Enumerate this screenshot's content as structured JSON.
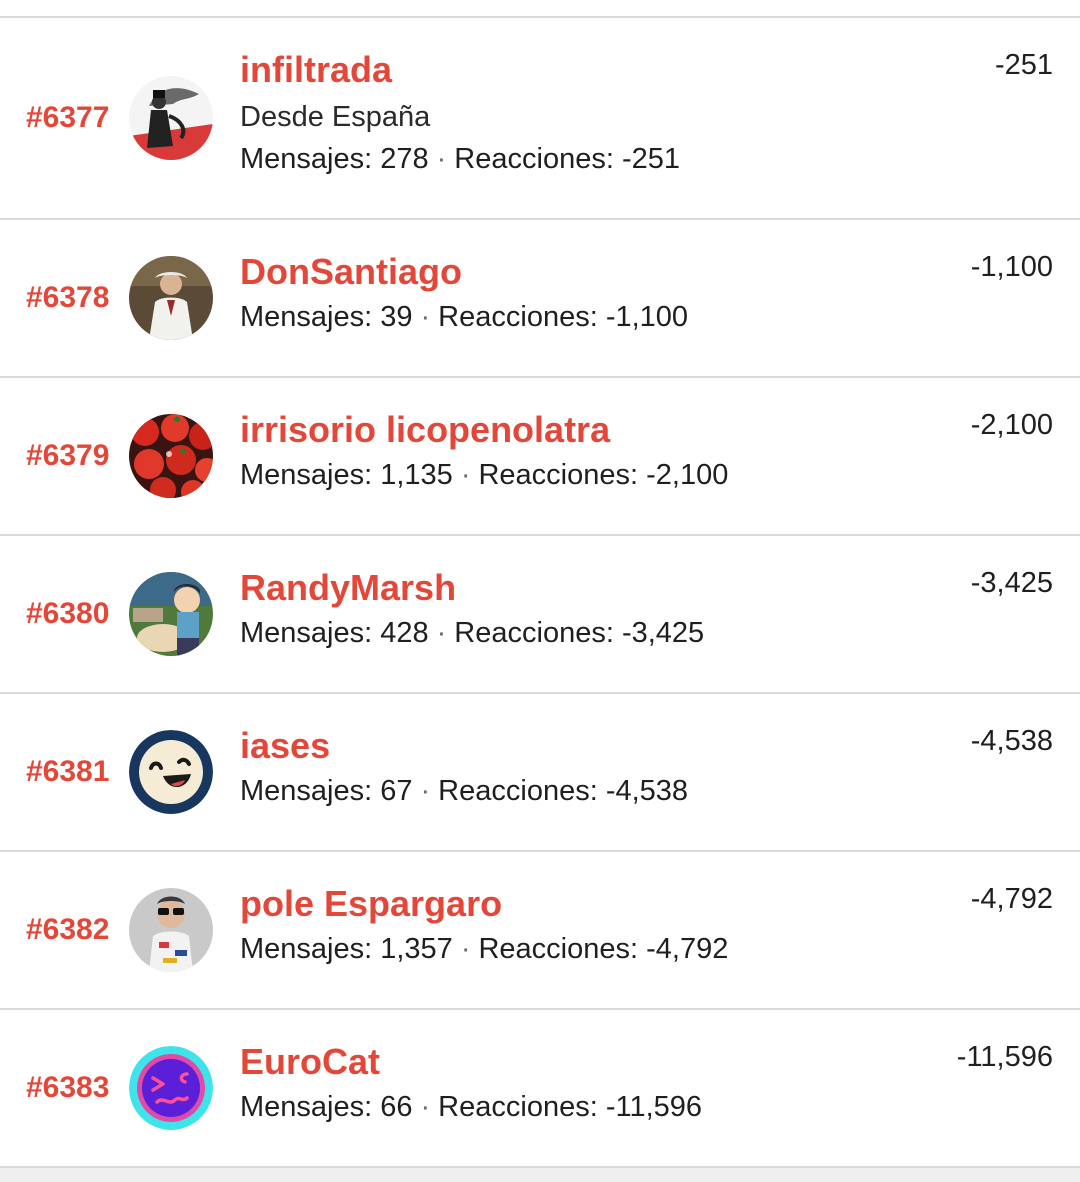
{
  "members": [
    {
      "rank": "#6377",
      "name": "infiltrada",
      "location": "Desde España",
      "messages_label": "Mensajes:",
      "messages": "278",
      "separator": "·",
      "reactions_label": "Reacciones:",
      "reactions": "-251",
      "score": "-251",
      "avatar_icon": "sketch-figure-avatar"
    },
    {
      "rank": "#6378",
      "name": "DonSantiago",
      "messages_label": "Mensajes:",
      "messages": "39",
      "separator": "·",
      "reactions_label": "Reacciones:",
      "reactions": "-1,100",
      "score": "-1,100",
      "avatar_icon": "man-in-white-coat-avatar"
    },
    {
      "rank": "#6379",
      "name": "irrisorio licopenolatra",
      "messages_label": "Mensajes:",
      "messages": "1,135",
      "separator": "·",
      "reactions_label": "Reacciones:",
      "reactions": "-2,100",
      "score": "-2,100",
      "avatar_icon": "tomatoes-avatar"
    },
    {
      "rank": "#6380",
      "name": "RandyMarsh",
      "messages_label": "Mensajes:",
      "messages": "428",
      "separator": "·",
      "reactions_label": "Reacciones:",
      "reactions": "-3,425",
      "score": "-3,425",
      "avatar_icon": "cartoon-character-avatar"
    },
    {
      "rank": "#6381",
      "name": "iases",
      "messages_label": "Mensajes:",
      "messages": "67",
      "separator": "·",
      "reactions_label": "Reacciones:",
      "reactions": "-4,538",
      "score": "-4,538",
      "avatar_icon": "laughing-face-avatar"
    },
    {
      "rank": "#6382",
      "name": "pole Espargaro",
      "messages_label": "Mensajes:",
      "messages": "1,357",
      "separator": "·",
      "reactions_label": "Reacciones:",
      "reactions": "-4,792",
      "score": "-4,792",
      "avatar_icon": "man-with-sunglasses-avatar"
    },
    {
      "rank": "#6383",
      "name": "EuroCat",
      "messages_label": "Mensajes:",
      "messages": "66",
      "separator": "·",
      "reactions_label": "Reacciones:",
      "reactions": "-11,596",
      "score": "-11,596",
      "avatar_icon": "purple-wincing-face-avatar"
    }
  ],
  "colors": {
    "accent": "#e2473a",
    "divider": "#dadada",
    "text": "#1f1f1f"
  }
}
